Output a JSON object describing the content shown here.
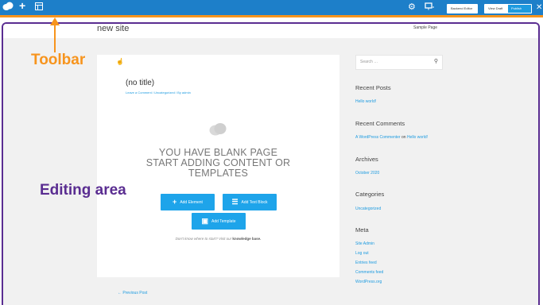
{
  "toolbar": {
    "backend_editor_label": "Backend Editor",
    "view_draft_label": "View Draft",
    "publish_label": "Publish"
  },
  "site": {
    "title": "new site",
    "nav_link": "Sample Page"
  },
  "post": {
    "title": "(no title)",
    "meta": "Leave a Comment / Uncategorized / By admin"
  },
  "blank_page": {
    "line1": "YOU HAVE BLANK PAGE",
    "line2": "START ADDING CONTENT OR",
    "line3": "TEMPLATES",
    "add_element_label": "Add Element",
    "add_text_block_label": "Add Text Block",
    "add_template_label": "Add Template",
    "help_text": "Don't know where to start? Visit our",
    "help_link": "knowledge base."
  },
  "navigation": {
    "previous_post": "← Previous Post"
  },
  "sidebar": {
    "search_placeholder": "Search …",
    "recent_posts_title": "Recent Posts",
    "recent_posts": [
      "Hello world!"
    ],
    "recent_comments_title": "Recent Comments",
    "comment_author": "A WordPress Commenter",
    "comment_on": "on",
    "comment_post": "Hello world!",
    "archives_title": "Archives",
    "archives": [
      "October 2020"
    ],
    "categories_title": "Categories",
    "categories": [
      "Uncategorized"
    ],
    "meta_title": "Meta",
    "meta_links": [
      "Site Admin",
      "Log out",
      "Entries feed",
      "Comments feed",
      "WordPress.org"
    ]
  },
  "annotations": {
    "toolbar_label": "Toolbar",
    "editing_area_label": "Editing area"
  },
  "colors": {
    "toolbar_bg": "#1d7fc9",
    "toolbar_accent": "#f7941d",
    "frame_border": "#5a2d91",
    "button_blue": "#1ea4ea"
  },
  "icons": [
    "logo-icon",
    "plus-icon",
    "layout-icon",
    "gear-icon",
    "monitor-icon",
    "close-icon",
    "cursor-icon",
    "cloud-icon",
    "search-icon",
    "text-block-icon",
    "template-icon"
  ]
}
